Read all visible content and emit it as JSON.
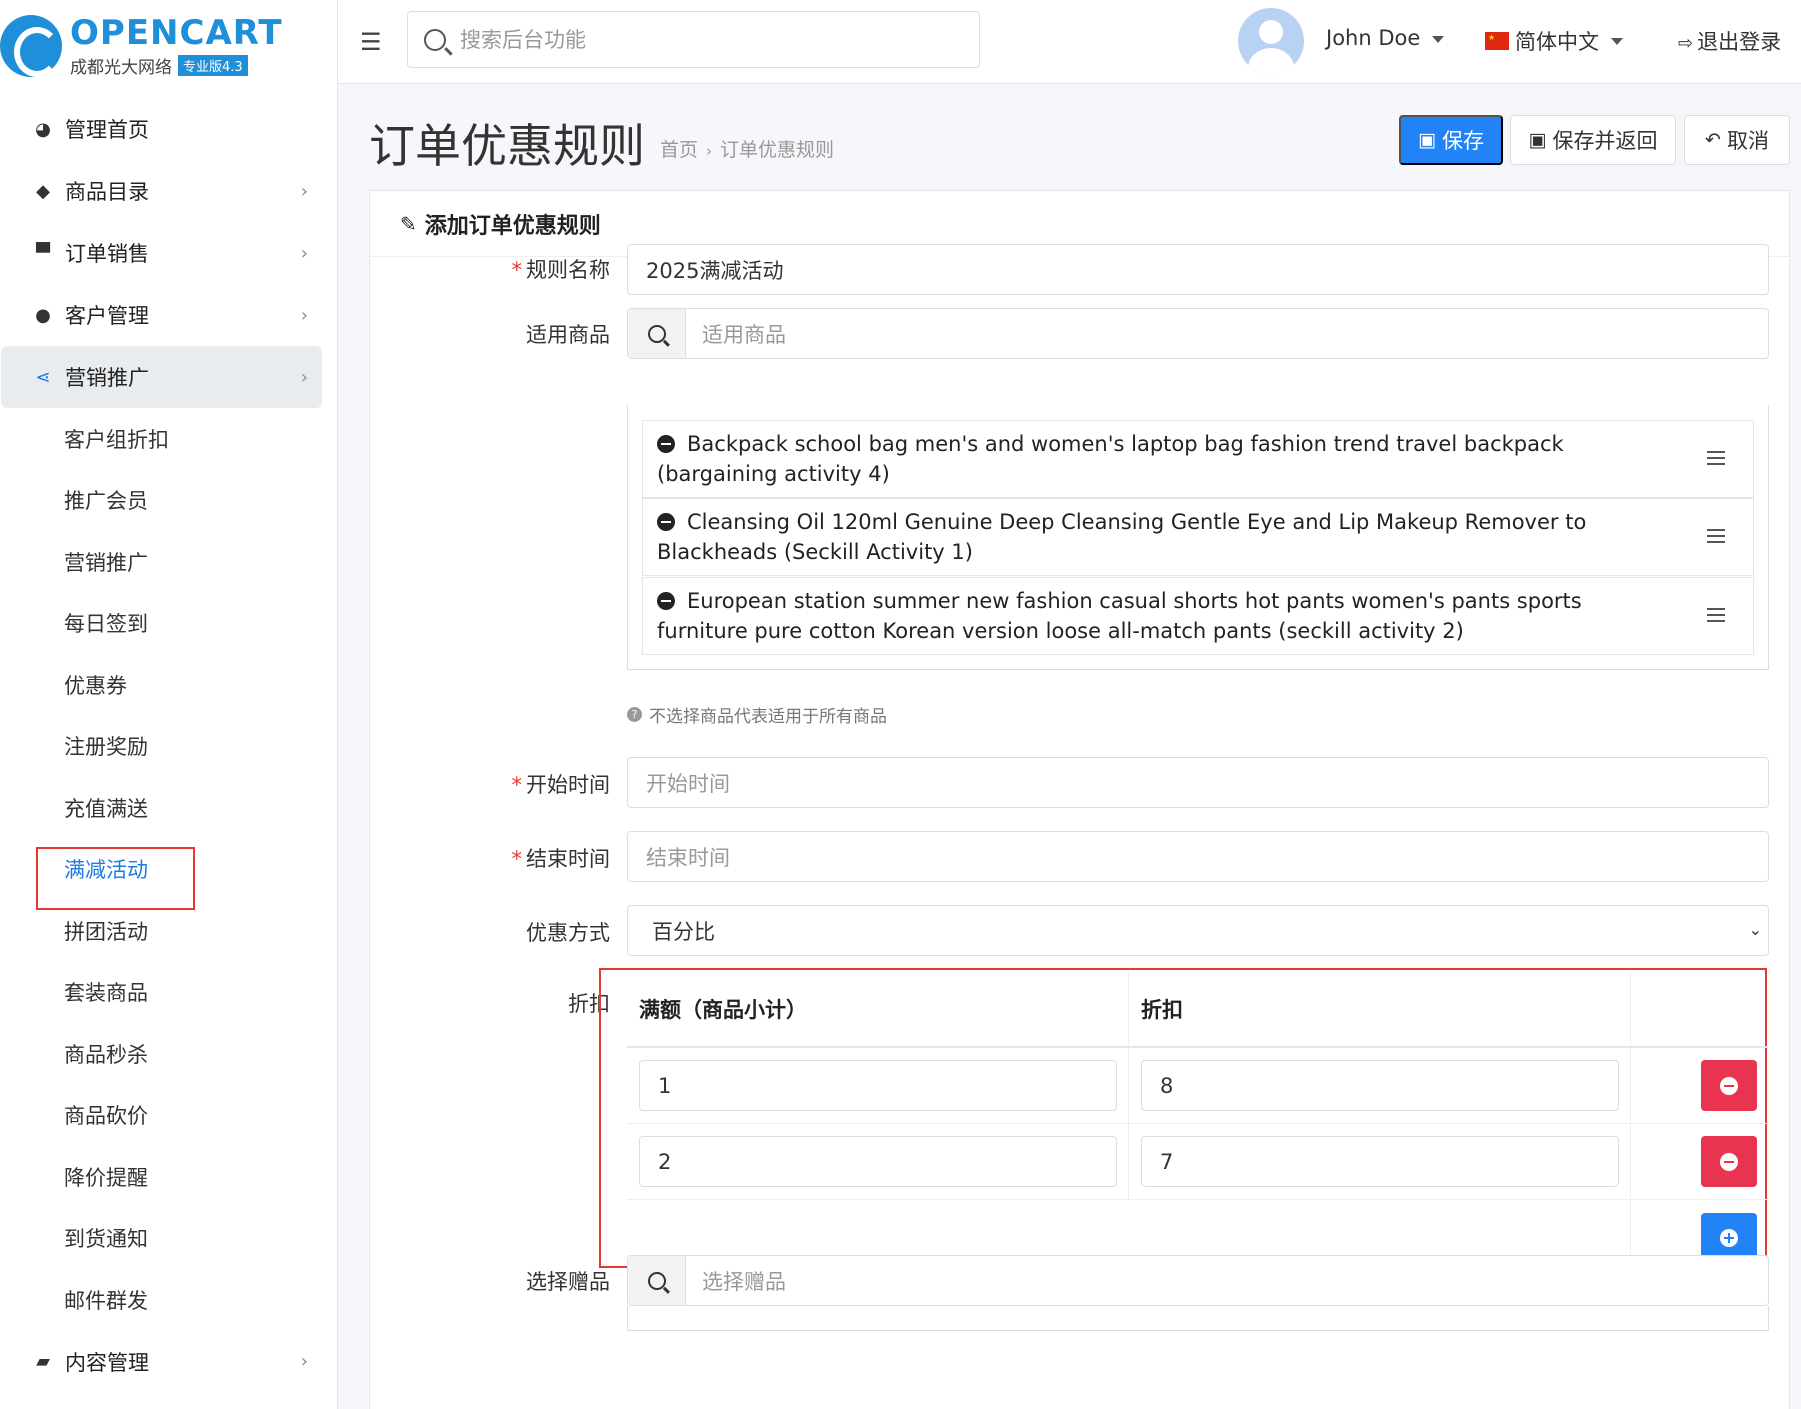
{
  "logo": {
    "title": "OPENCART",
    "subtitle": "成都光大网络",
    "badge": "专业版4.3"
  },
  "sidebar": {
    "items": [
      {
        "label": "管理首页",
        "icon": "dashboard-icon"
      },
      {
        "label": "商品目录",
        "icon": "tags-icon"
      },
      {
        "label": "订单销售",
        "icon": "cart-icon"
      },
      {
        "label": "客户管理",
        "icon": "user-icon"
      },
      {
        "label": "营销推广",
        "icon": "share-icon"
      }
    ],
    "submenu": [
      "客户组折扣",
      "推广会员",
      "营销推广",
      "每日签到",
      "优惠券",
      "注册奖励",
      "充值满送",
      "满减活动",
      "拼团活动",
      "套装商品",
      "商品秒杀",
      "商品砍价",
      "降价提醒",
      "到货通知",
      "邮件群发"
    ],
    "content_item": {
      "label": "内容管理",
      "icon": "book-icon"
    }
  },
  "header": {
    "search_placeholder": "搜索后台功能",
    "user_name": "John Doe",
    "language": "简体中文",
    "logout": "退出登录"
  },
  "page": {
    "title": "订单优惠规则",
    "breadcrumb": [
      "首页",
      "订单优惠规则"
    ],
    "buttons": {
      "save": "保存",
      "save_back": "保存并返回",
      "cancel": "取消"
    }
  },
  "form": {
    "card_title": "添加订单优惠规则",
    "rule_name_label": "规则名称",
    "rule_name_value": "2025满减活动",
    "products_label": "适用商品",
    "products_placeholder": "适用商品",
    "products": [
      "Backpack school bag men's and women's laptop bag fashion trend travel backpack (bargaining activity 4)",
      "Cleansing Oil 120ml Genuine Deep Cleansing Gentle Eye and Lip Makeup Remover to Blackheads (Seckill Activity 1)",
      "European station summer new fashion casual shorts hot pants women's pants sports furniture pure cotton Korean version loose all-match pants (seckill activity 2)"
    ],
    "products_help": "不选择商品代表适用于所有商品",
    "start_label": "开始时间",
    "start_placeholder": "开始时间",
    "end_label": "结束时间",
    "end_placeholder": "结束时间",
    "type_label": "优惠方式",
    "type_value": "百分比",
    "discount_label": "折扣",
    "discount_table": {
      "headers": [
        "满额（商品小计）",
        "折扣"
      ],
      "rows": [
        {
          "amount": "1",
          "discount": "8"
        },
        {
          "amount": "2",
          "discount": "7"
        }
      ]
    },
    "gift_label": "选择赠品",
    "gift_placeholder": "选择赠品"
  }
}
